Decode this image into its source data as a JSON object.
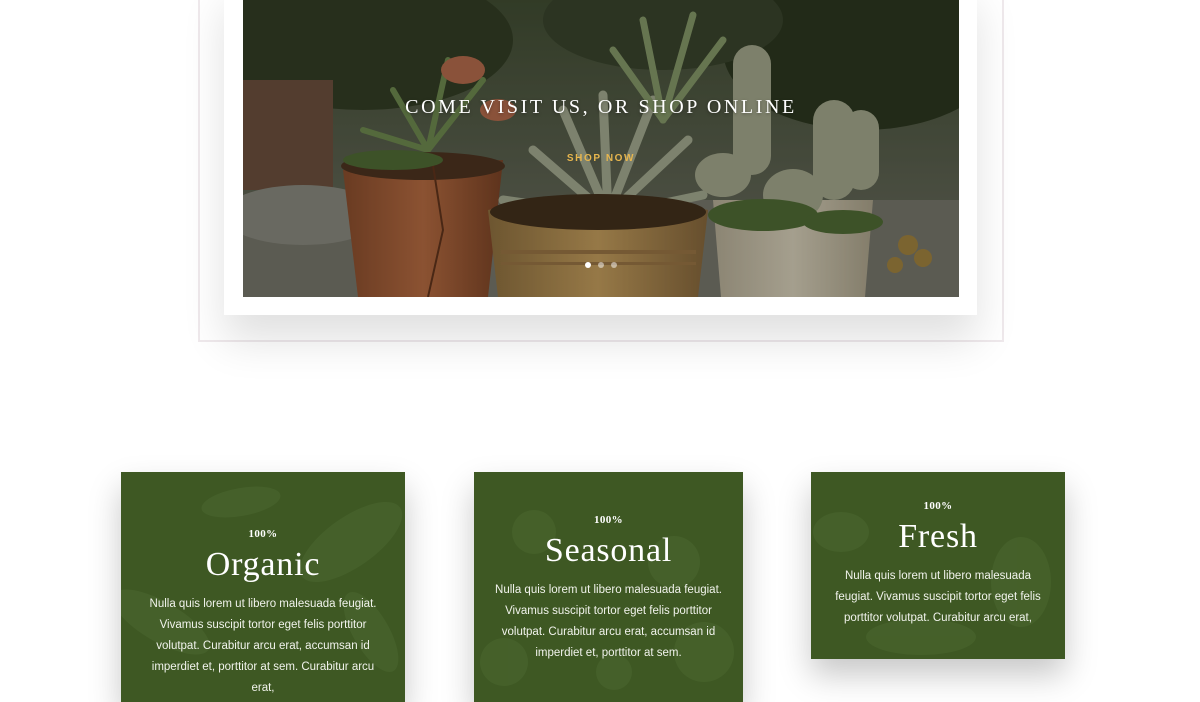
{
  "hero": {
    "heading": "COME VISIT US, OR SHOP ONLINE",
    "cta_label": "SHOP NOW",
    "slides": [
      {
        "active": true
      },
      {
        "active": false
      },
      {
        "active": false
      }
    ]
  },
  "features": [
    {
      "percent": "100%",
      "title": "Organic",
      "text": "Nulla quis lorem ut libero malesuada feugiat. Vivamus suscipit tortor eget felis porttitor volutpat. Curabitur arcu erat, accumsan id imperdiet et, porttitor at sem. Curabitur arcu erat,"
    },
    {
      "percent": "100%",
      "title": "Seasonal",
      "text": "Nulla quis lorem ut libero malesuada feugiat. Vivamus suscipit tortor eget felis porttitor volutpat. Curabitur arcu erat, accumsan id imperdiet et, porttitor at sem."
    },
    {
      "percent": "100%",
      "title": "Fresh",
      "text": "Nulla quis lorem ut libero malesuada feugiat. Vivamus suscipit tortor eget felis porttitor volutpat. Curabitur arcu erat,"
    }
  ],
  "colors": {
    "card_green": "#3e5823",
    "cta_gold": "#e7b64e"
  }
}
